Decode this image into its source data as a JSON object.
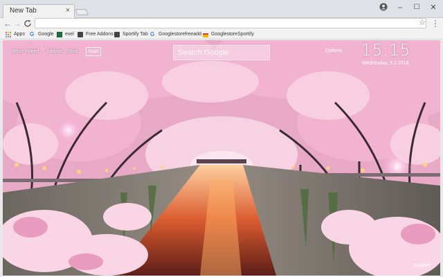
{
  "browser": {
    "tab_title": "New Tab",
    "tab_close": "×",
    "window_controls": {
      "minimize": "–",
      "maximize": "☐",
      "close": "✕"
    }
  },
  "toolbar": {
    "back": "←",
    "forward": "→",
    "reload": "C",
    "star": "☆",
    "menu": "⋮",
    "address_value": ""
  },
  "bookmarks": [
    {
      "label": "Apps",
      "icon": "apps-grid-icon"
    },
    {
      "label": "Google",
      "icon": "google-icon"
    },
    {
      "label": "exel",
      "icon": "excel-icon"
    },
    {
      "label": "Free Addons",
      "icon": "addons-icon"
    },
    {
      "label": "Sportify Tab",
      "icon": "sportify-icon"
    },
    {
      "label": "Googlestorefreeadd",
      "icon": "google-icon"
    },
    {
      "label": "GooglestoreSportify",
      "icon": "store-icon"
    }
  ],
  "page": {
    "nav": {
      "most_visited": "Most Visited",
      "addons": "Addons",
      "shop": "Shop",
      "apps": "Apps"
    },
    "search_placeholder": "Search Google",
    "options": "Options",
    "time": "15:15",
    "date": "Wednesday, 5.2.2018",
    "support": "Support"
  },
  "colors": {
    "chrome_frame": "#dee1e6",
    "toolbar": "#f2f2f2",
    "blossom_pink": "#f3b6cf",
    "canal_glow": "#ff9a4d"
  }
}
